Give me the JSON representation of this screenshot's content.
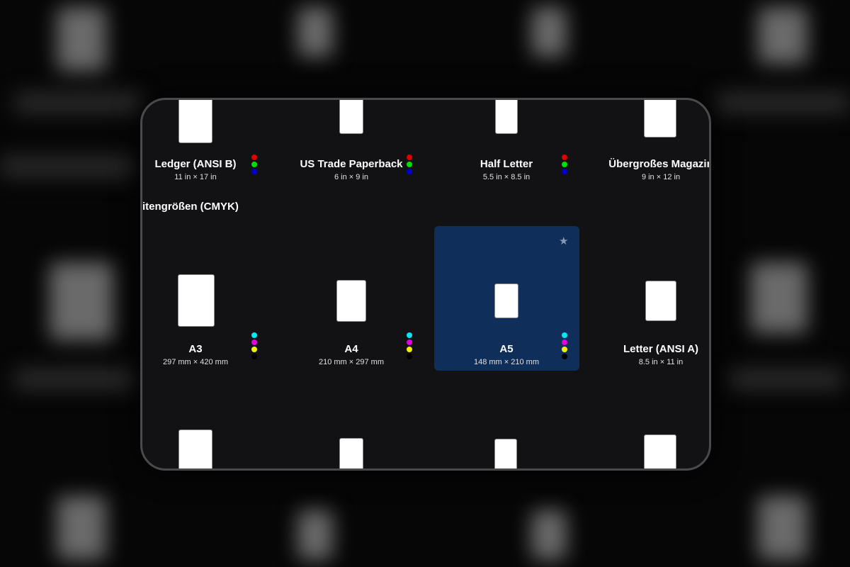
{
  "section_title": "itengrößen (CMYK)",
  "rgb_colors": [
    "#e00000",
    "#00e000",
    "#0000d0"
  ],
  "cmyk_colors": [
    "#00e8f0",
    "#e000e0",
    "#f0f000",
    "#000000"
  ],
  "top_row": [
    {
      "label": "Ledger (ANSI B)",
      "dims": "11 in × 17 in"
    },
    {
      "label": "US Trade Paperback",
      "dims": "6 in × 9 in"
    },
    {
      "label": "Half Letter",
      "dims": "5.5 in × 8.5 in"
    },
    {
      "label": "Übergroßes Magazin",
      "dims": "9 in × 12 in"
    }
  ],
  "middle_row": [
    {
      "label": "A3",
      "dims": "297 mm × 420 mm"
    },
    {
      "label": "A4",
      "dims": "210 mm × 297 mm"
    },
    {
      "label": "A5",
      "dims": "148 mm × 210 mm",
      "selected": true,
      "favorite_icon": "star-icon"
    },
    {
      "label": "Letter (ANSI A)",
      "dims": "8.5 in × 11 in"
    }
  ],
  "selection_color": "#0f2e59"
}
